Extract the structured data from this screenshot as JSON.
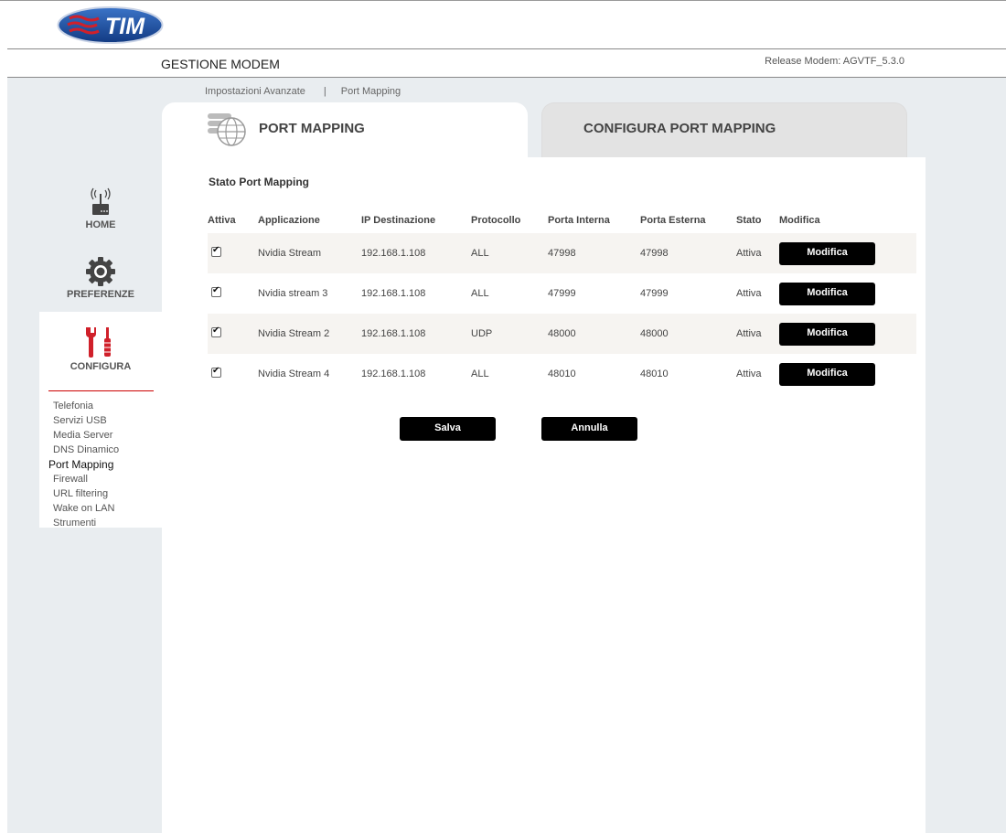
{
  "header": {
    "logo_text": "TIM",
    "app_title": "GESTIONE MODEM",
    "release": "Release Modem: AGVTF_5.3.0"
  },
  "breadcrumb": {
    "section": "Impostazioni Avanzate",
    "separator": "|",
    "page": "Port Mapping"
  },
  "tabs": [
    {
      "label": "PORT MAPPING",
      "active": true
    },
    {
      "label": "CONFIGURA PORT MAPPING",
      "active": false
    }
  ],
  "sidebar": {
    "items": [
      {
        "label": "HOME",
        "icon": "router-icon"
      },
      {
        "label": "PREFERENZE",
        "icon": "gear-icon"
      },
      {
        "label": "CONFIGURA",
        "icon": "tools-icon"
      }
    ],
    "submenu": [
      "Telefonia",
      "Servizi USB",
      "Media Server",
      "DNS Dinamico",
      "Port Mapping",
      "Firewall",
      "URL filtering",
      "Wake on LAN",
      "Strumenti"
    ],
    "active_submenu": "Port Mapping"
  },
  "main": {
    "section_title": "Stato Port Mapping",
    "columns": [
      "Attiva",
      "Applicazione",
      "IP Destinazione",
      "Protocollo",
      "Porta Interna",
      "Porta Esterna",
      "Stato",
      "Modifica"
    ],
    "rows": [
      {
        "attiva": true,
        "applicazione": "Nvidia Stream",
        "ip": "192.168.1.108",
        "protocollo": "ALL",
        "porta_interna": "47998",
        "porta_esterna": "47998",
        "stato": "Attiva",
        "modifica": "Modifica"
      },
      {
        "attiva": true,
        "applicazione": "Nvidia stream 3",
        "ip": "192.168.1.108",
        "protocollo": "ALL",
        "porta_interna": "47999",
        "porta_esterna": "47999",
        "stato": "Attiva",
        "modifica": "Modifica"
      },
      {
        "attiva": true,
        "applicazione": "Nvidia Stream 2",
        "ip": "192.168.1.108",
        "protocollo": "UDP",
        "porta_interna": "48000",
        "porta_esterna": "48000",
        "stato": "Attiva",
        "modifica": "Modifica"
      },
      {
        "attiva": true,
        "applicazione": "Nvidia Stream 4",
        "ip": "192.168.1.108",
        "protocollo": "ALL",
        "porta_interna": "48010",
        "porta_esterna": "48010",
        "stato": "Attiva",
        "modifica": "Modifica"
      }
    ],
    "buttons": {
      "save": "Salva",
      "cancel": "Annulla"
    }
  },
  "colors": {
    "brand_blue": "#1c4f9c",
    "brand_red": "#d0202a",
    "panel_bg": "#e9edf0",
    "button_bg": "#000000"
  }
}
